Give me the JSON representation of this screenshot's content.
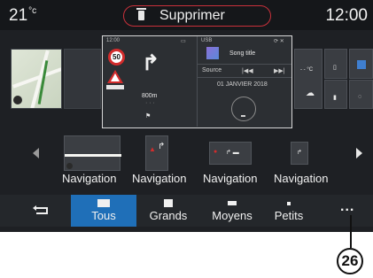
{
  "topbar": {
    "temperature": "21",
    "temperature_unit": "°c",
    "delete_label": "Supprimer",
    "clock": "12:00"
  },
  "nav_widget": {
    "status_time": "12:00",
    "speed_limit": "50",
    "distance": "800m"
  },
  "music_widget": {
    "source_name": "USB",
    "song_title": "Song title",
    "source_label": "Source",
    "prev_icon": "previous-track-icon",
    "next_icon": "next-track-icon",
    "date": "01 JANVIER 2018"
  },
  "right_widgets": {
    "temp_placeholder": "- - °C"
  },
  "carousel": {
    "items": [
      {
        "label": "Navigation"
      },
      {
        "label": "Navigation"
      },
      {
        "label": "Navigation"
      },
      {
        "label": "Navigation"
      }
    ]
  },
  "tabbar": {
    "tabs": [
      {
        "label": "Tous",
        "active": true
      },
      {
        "label": "Grands",
        "active": false
      },
      {
        "label": "Moyens",
        "active": false
      },
      {
        "label": "Petits",
        "active": false
      }
    ],
    "more_label": "..."
  },
  "callout": {
    "number": "26"
  },
  "colors": {
    "accent_active_tab": "#1f6fb8",
    "delete_border": "#c9313b",
    "background": "#1e2024"
  }
}
